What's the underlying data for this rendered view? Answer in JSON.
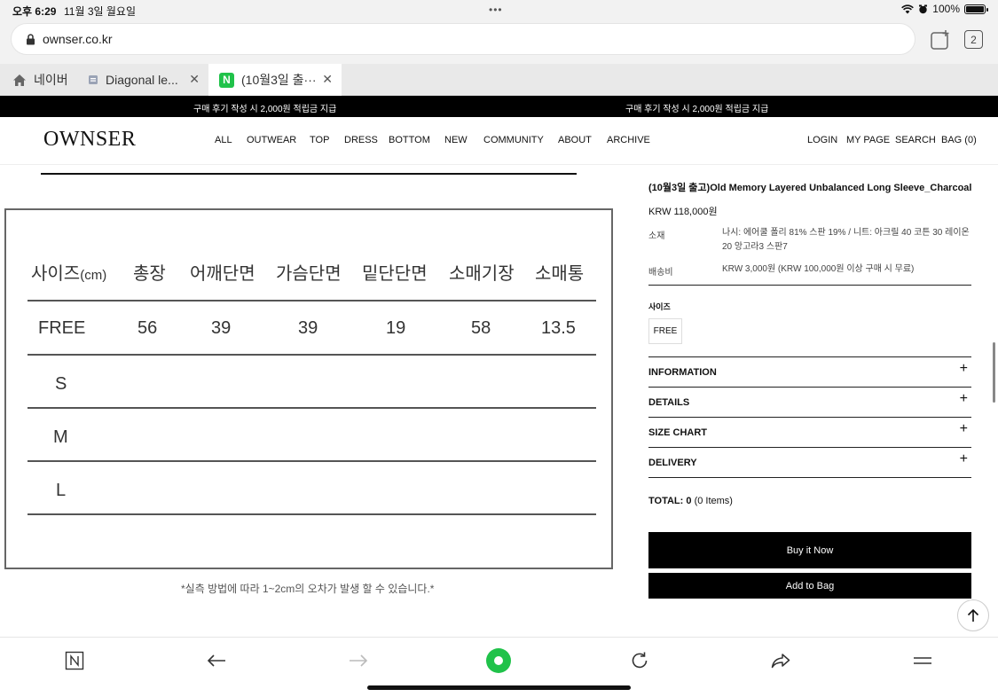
{
  "status_bar": {
    "time": "오후 6:29",
    "date": "11월 3일 월요일",
    "dots": "•••",
    "battery": "100%"
  },
  "address_bar": {
    "url": "ownser.co.kr",
    "tab_count": "2"
  },
  "tabs": [
    {
      "label": "네이버",
      "icon": "home-icon"
    },
    {
      "label": "Diagonal le...",
      "icon": "page-icon"
    },
    {
      "label": "(10월3일 출···",
      "icon": "naver-n-icon",
      "badge": "N"
    }
  ],
  "announcement": {
    "left": "구매 후기 작성 시 2,000원 적립금 지급",
    "right": "구매 후기 작성 시 2,000원 적립금 지급"
  },
  "site": {
    "logo": "OWNSER",
    "nav": [
      "ALL",
      "OUTWEAR",
      "TOP",
      "DRESS",
      "BOTTOM",
      "NEW",
      "COMMUNITY",
      "ABOUT",
      "ARCHIVE"
    ],
    "util": [
      "LOGIN",
      "MY PAGE",
      "SEARCH",
      "BAG (0)"
    ]
  },
  "size_table": {
    "header_main": "사이즈",
    "header_unit": "(cm)",
    "headers": [
      "총장",
      "어깨단면",
      "가슴단면",
      "밑단단면",
      "소매기장",
      "소매통"
    ],
    "rows": [
      {
        "size": "FREE",
        "values": [
          "56",
          "39",
          "39",
          "19",
          "58",
          "13.5"
        ]
      },
      {
        "size": "S",
        "values": [
          "",
          "",
          "",
          "",
          "",
          ""
        ]
      },
      {
        "size": "M",
        "values": [
          "",
          "",
          "",
          "",
          "",
          ""
        ]
      },
      {
        "size": "L",
        "values": [
          "",
          "",
          "",
          "",
          "",
          ""
        ]
      }
    ],
    "note": "*실측 방법에 따라 1~2cm의 오차가 발생 할 수 있습니다.*"
  },
  "product": {
    "title": "(10월3일 출고)Old Memory Layered Unbalanced Long Sleeve_Charcoal",
    "price": "KRW 118,000원",
    "material_label": "소재",
    "material_value": "나시: 에어쿨 폴리 81% 스판 19% / 니트: 아크릴 40 코튼 30 레이온20 앙고라3 스판7",
    "shipping_label": "배송비",
    "shipping_value": "KRW 3,000원 (KRW 100,000원 이상 구매 시 무료)",
    "size_label": "사이즈",
    "size_option": "FREE",
    "accordions": [
      "INFORMATION",
      "DETAILS",
      "SIZE CHART",
      "DELIVERY"
    ],
    "total_label": "TOTAL:",
    "total_value": "0",
    "total_items": "(0 Items)",
    "buy_now": "Buy it Now",
    "add_to_bag": "Add to Bag"
  },
  "colors": {
    "naver_green": "#20c24a",
    "black": "#000000"
  }
}
